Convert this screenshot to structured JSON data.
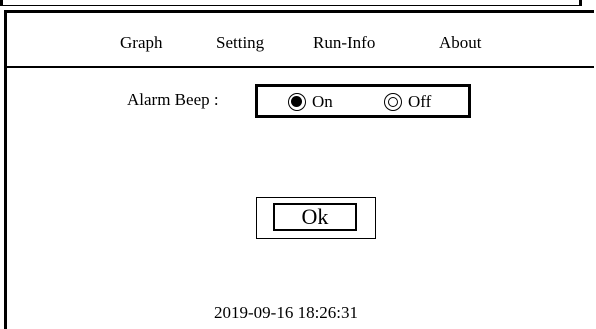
{
  "menu": {
    "items": [
      {
        "label": "Graph"
      },
      {
        "label": "Setting"
      },
      {
        "label": "Run-Info"
      },
      {
        "label": "About"
      }
    ]
  },
  "settings": {
    "alarm_beep_label": "Alarm Beep :",
    "options": [
      {
        "label": "On",
        "selected": true
      },
      {
        "label": "Off",
        "selected": false
      }
    ]
  },
  "ok_button": {
    "label": "Ok"
  },
  "status": {
    "timestamp": "2019-09-16 18:26:31"
  }
}
